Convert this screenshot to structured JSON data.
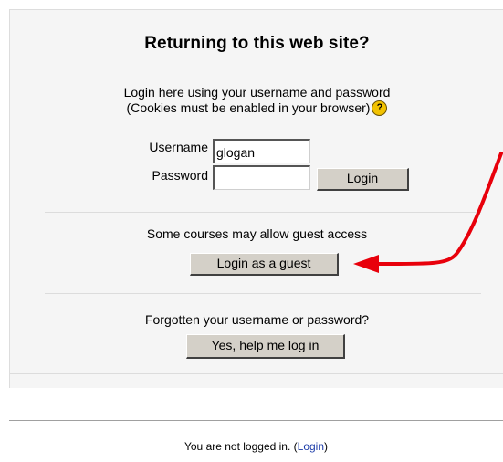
{
  "login": {
    "heading": "Returning to this web site?",
    "desc_line1": "Login here using your username and password",
    "desc_line2": "(Cookies must be enabled in your browser)",
    "help_icon": "question-help-icon",
    "username_label": "Username",
    "username_value": "glogan",
    "password_label": "Password",
    "password_value": "",
    "login_button": "Login"
  },
  "guest": {
    "message": "Some courses may allow guest access",
    "button": "Login as a guest"
  },
  "forgot": {
    "message": "Forgotten your username or password?",
    "button": "Yes, help me log in"
  },
  "footer": {
    "text": "You are not logged in. (",
    "link": "Login",
    "text_end": ")"
  },
  "colors": {
    "annotation_arrow": "#e8000b",
    "panel_bg": "#f5f5f5",
    "button_bg": "#d4d0c8",
    "link": "#1a3aa8"
  }
}
